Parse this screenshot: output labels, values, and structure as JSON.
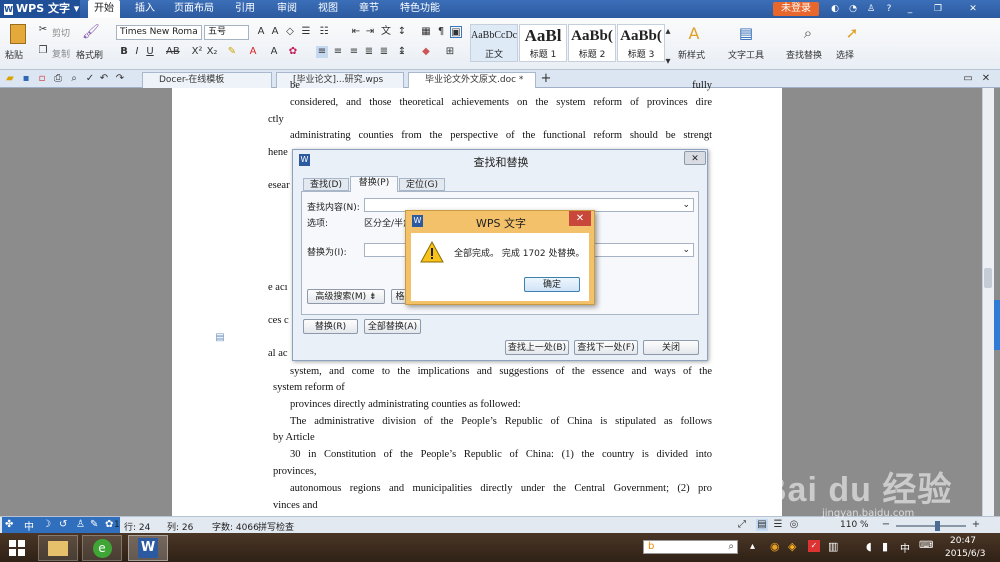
{
  "app": {
    "name": "WPS 文字",
    "login": "未登录"
  },
  "menu": [
    "开始",
    "插入",
    "页面布局",
    "引用",
    "审阅",
    "视图",
    "章节",
    "特色功能"
  ],
  "ribbon": {
    "paste": "粘贴",
    "cut": "剪切",
    "copy": "复制",
    "format_painter": "格式刷",
    "font": "Times New Roma",
    "size": "五号",
    "styles": [
      {
        "preview": "AaBbCcDc",
        "name": "正文"
      },
      {
        "preview": "AaBl",
        "name": "标题 1"
      },
      {
        "preview": "AaBb(",
        "name": "标题 2"
      },
      {
        "preview": "AaBb(",
        "name": "标题 3"
      }
    ],
    "new_style": "新样式",
    "text_tools": "文字工具",
    "find_replace": "查找替换",
    "select": "选择"
  },
  "tabs": [
    {
      "label": "Docer-在线模板"
    },
    {
      "label": "[毕业论文]...研究.wps"
    },
    {
      "label": "毕业论文外文原文.doc *"
    }
  ],
  "document": {
    "lines": [
      {
        "text": "be fully",
        "indent": true
      },
      {
        "text": "considered, and those theoretical achievements on the system reform of provinces dire",
        "indent": true
      },
      {
        "text": "ctly",
        "indent": false
      },
      {
        "text": "administrating counties from the perspective of the functional reform should be strengt",
        "indent": true
      },
      {
        "text": "hene",
        "indent": false
      },
      {
        "text": "esear",
        "indent": false
      },
      {
        "text": "e acı",
        "indent": false
      },
      {
        "text": "ces c",
        "indent": false
      },
      {
        "text": "al ac",
        "indent": false
      },
      {
        "text": "system, and come to the implications and suggestions of the essence and ways of the",
        "indent": true
      },
      {
        "text": "system reform of",
        "indent": false
      },
      {
        "text": "provinces directly administrating counties as followed:",
        "indent": true
      },
      {
        "text": "The administrative division of the People’s Republic of China is stipulated as follows",
        "indent": true
      },
      {
        "text": "by Article",
        "indent": false
      },
      {
        "text": "30 in Constitution of the People’s Republic of China: (1) the country is divided into",
        "indent": true
      },
      {
        "text": "provinces,",
        "indent": false
      },
      {
        "text": "autonomous regions and municipalities directly under the Central Government; (2) pro",
        "indent": true
      },
      {
        "text": "vinces and",
        "indent": false
      }
    ]
  },
  "find_dialog": {
    "title": "查找和替换",
    "tabs": [
      "查找(D)",
      "替换(P)",
      "定位(G)"
    ],
    "find_label": "查找内容(N):",
    "options_label": "选项:",
    "options_value": "区分全/半角",
    "replace_label": "替换为(I):",
    "advanced": "高级搜索(M)",
    "format_partial": "格",
    "replace_btn": "替换(R)",
    "replace_all": "全部替换(A)",
    "find_prev": "查找上一处(B)",
    "find_next": "查找下一处(F)",
    "close": "关闭"
  },
  "message": {
    "title": "WPS 文字",
    "text": "全部完成。 完成 1702 处替换。",
    "ok": "确定"
  },
  "status": {
    "row": "行: 24",
    "col": "列: 26",
    "words": "字数: 4066",
    "spell": "拼写检查",
    "zoom": "110 %",
    "page_frag": "1"
  },
  "taskbar": {
    "time": "20:47",
    "date": "2015/6/3",
    "ime": "中"
  },
  "watermark": {
    "brand": "Bai du 经验",
    "url": "jingyan.baidu.com"
  }
}
